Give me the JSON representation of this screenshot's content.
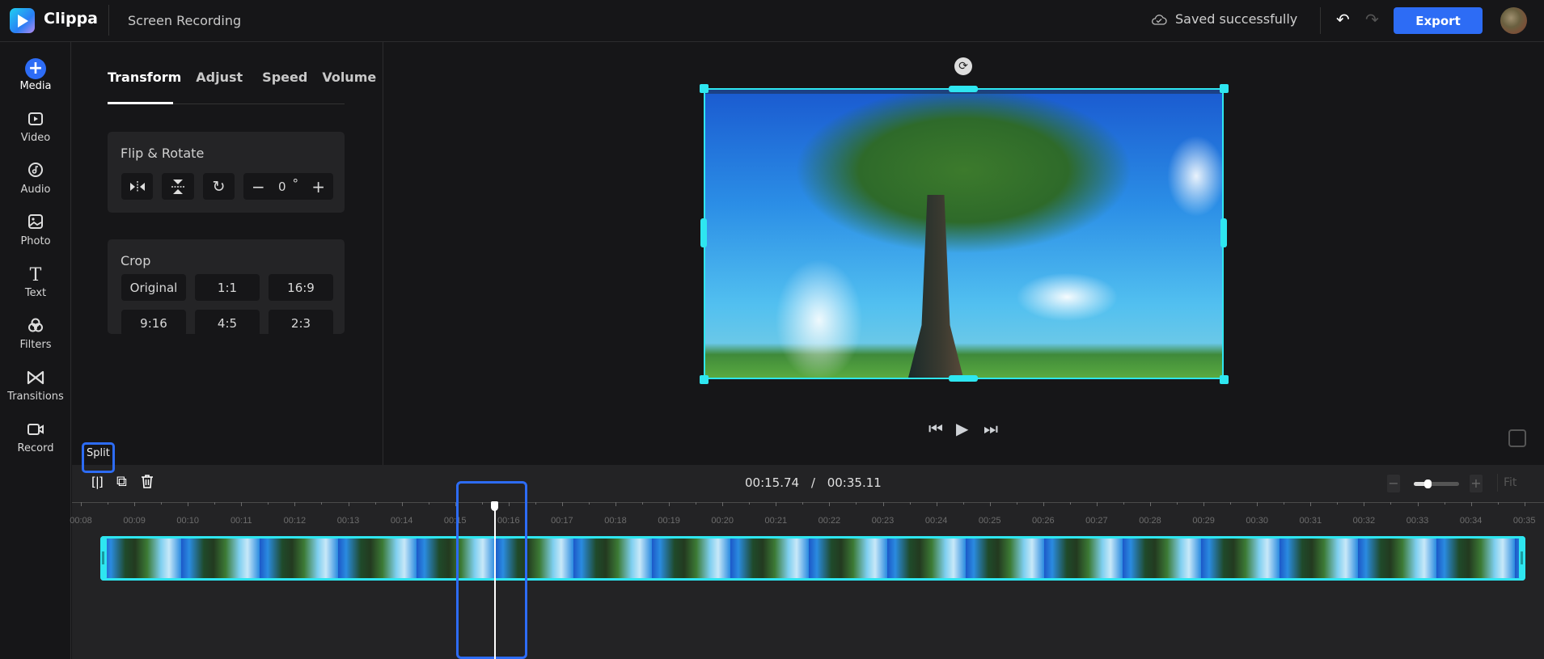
{
  "app": {
    "brand": "Clippa",
    "project_title": "Screen Recording",
    "save_status": "Saved successfully",
    "undo_icon": "↶",
    "redo_icon": "↷",
    "export_label": "Export",
    "accent_color": "#2d6cf5",
    "selection_color": "#2ee6f0"
  },
  "sidebar": {
    "items": [
      {
        "label": "Media",
        "icon": "+",
        "active": true
      },
      {
        "label": "Video",
        "icon": "▶"
      },
      {
        "label": "Audio",
        "icon": "♪"
      },
      {
        "label": "Photo",
        "icon": "▨"
      },
      {
        "label": "Text",
        "icon": "T"
      },
      {
        "label": "Filters",
        "icon": "☘"
      },
      {
        "label": "Transitions",
        "icon": "⋈"
      },
      {
        "label": "Record",
        "icon": "▭"
      }
    ]
  },
  "panel": {
    "tabs": [
      {
        "label": "Transform",
        "active": true
      },
      {
        "label": "Adjust"
      },
      {
        "label": "Speed"
      },
      {
        "label": "Volume"
      }
    ],
    "flip_rotate": {
      "title": "Flip & Rotate",
      "flip_horizontal_icon": "⧓",
      "flip_vertical_icon": "⧗",
      "rotate_icon": "↻",
      "minus": "−",
      "angle_value": "0",
      "degree": "°",
      "plus": "+"
    },
    "crop": {
      "title": "Crop",
      "options": [
        "Original",
        "1:1",
        "16:9",
        "9:16",
        "4:5",
        "2:3"
      ]
    }
  },
  "preview": {
    "rotate_icon": "⟳",
    "prev_icon": "⏮",
    "play_icon": "▶",
    "next_icon": "⏭"
  },
  "timeline": {
    "split_tooltip": "Split",
    "split_icon": "[|]",
    "duplicate_icon": "⧉",
    "delete_icon": "🗑",
    "current_time": "00:15.74",
    "separator": "/",
    "total_time": "00:35.11",
    "zoom_minus": "−",
    "zoom_plus": "+",
    "zoom_level": 0.3,
    "fit_label": "Fit",
    "ruler_labels": [
      "00:08",
      "00:09",
      "00:10",
      "00:11",
      "00:12",
      "00:13",
      "00:14",
      "00:15",
      "00:16",
      "00:17",
      "00:18",
      "00:19",
      "00:20",
      "00:21",
      "00:22",
      "00:23",
      "00:24",
      "00:25",
      "00:26",
      "00:27",
      "00:28",
      "00:29",
      "00:30",
      "00:31",
      "00:32",
      "00:33",
      "00:34",
      "00:35"
    ],
    "playhead_seconds": 15.74
  }
}
